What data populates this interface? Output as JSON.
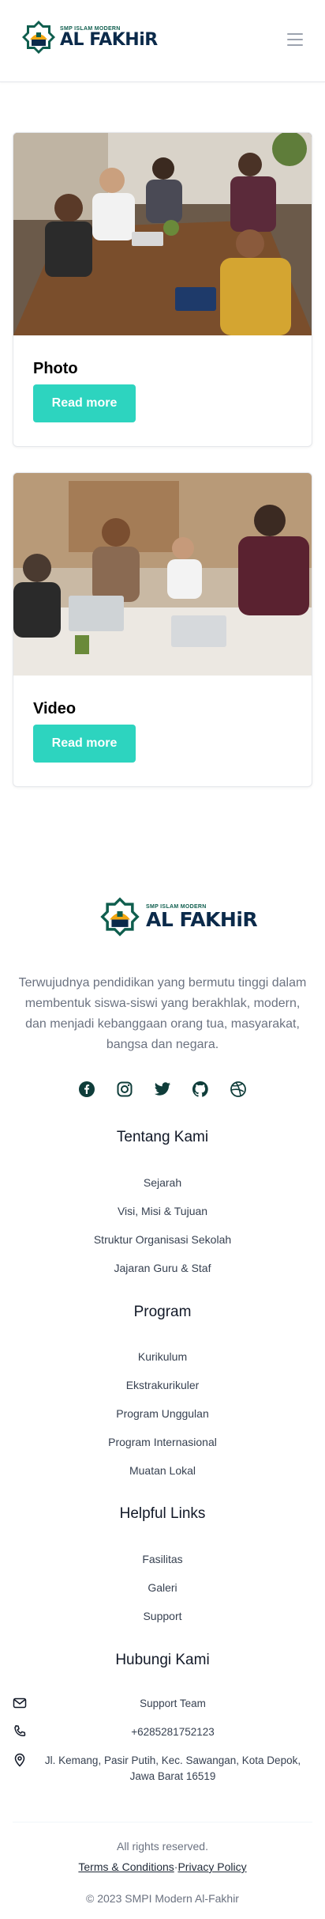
{
  "brand": {
    "small": "SMP ISLAM MODERN",
    "big": "AL FAKHiR",
    "colors": {
      "accent": "#2dd4bf",
      "navy": "#0b2a4a",
      "green": "#0f5e4e",
      "gold": "#f3a712"
    }
  },
  "header": {
    "menu_icon": "hamburger-icon"
  },
  "cards": [
    {
      "title": "Photo",
      "button": "Read more"
    },
    {
      "title": "Video",
      "button": "Read more"
    }
  ],
  "footer": {
    "mission": "Terwujudnya pendidikan yang bermutu tinggi dalam membentuk siswa-siswi yang berakhlak, modern, dan menjadi kebanggaan orang tua, masyarakat, bangsa dan negara.",
    "socials": [
      "facebook-icon",
      "instagram-icon",
      "twitter-icon",
      "github-icon",
      "dribbble-icon"
    ],
    "sections": [
      {
        "title": "Tentang Kami",
        "links": [
          "Sejarah",
          "Visi, Misi & Tujuan",
          "Struktur Organisasi Sekolah",
          "Jajaran Guru & Staf"
        ]
      },
      {
        "title": "Program",
        "links": [
          "Kurikulum",
          "Ekstrakurikuler",
          "Program Unggulan",
          "Program Internasional",
          "Muatan Lokal"
        ]
      },
      {
        "title": "Helpful Links",
        "links": [
          "Fasilitas",
          "Galeri",
          "Support"
        ]
      }
    ],
    "contact": {
      "title": "Hubungi Kami",
      "email": "Support Team",
      "phone": "+6285281752123",
      "address": "Jl. Kemang, Pasir Putih, Kec. Sawangan, Kota Depok, Jawa Barat 16519"
    },
    "rights": "All rights reserved.",
    "terms": "Terms & Conditions",
    "separator": "·",
    "privacy": "Privacy Policy",
    "copyright": "© 2023 SMPI Modern Al-Fakhir"
  }
}
